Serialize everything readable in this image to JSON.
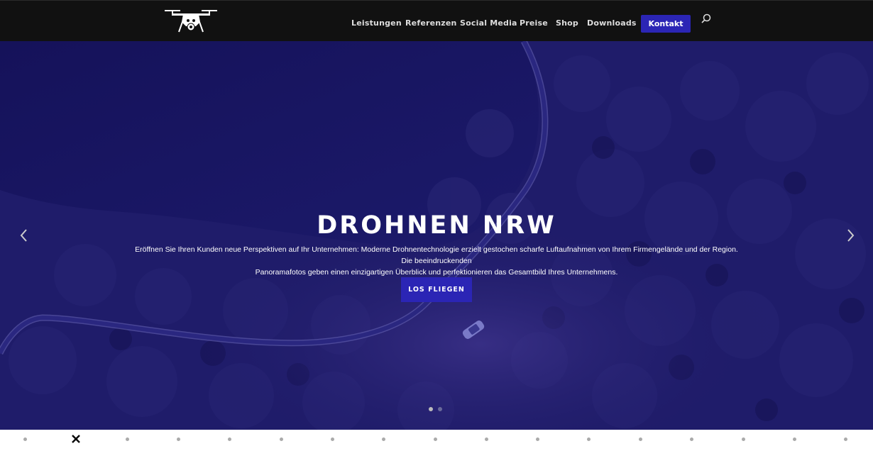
{
  "colors": {
    "header_bg": "#111111",
    "accent": "#2b25b5",
    "hero_overlay": "#1a1760",
    "nav_text": "#dddddd"
  },
  "header": {
    "logo_icon": "drone-logo-icon",
    "nav": [
      {
        "label": "Leistungen"
      },
      {
        "label": "Referenzen"
      },
      {
        "label": "Social Media"
      },
      {
        "label": "Preise"
      },
      {
        "label": "Shop"
      },
      {
        "label": "Downloads"
      }
    ],
    "cta_label": "Kontakt",
    "search_icon": "search-icon"
  },
  "hero": {
    "title": "DROHNEN NRW",
    "text_line1": "Eröffnen Sie Ihren Kunden neue Perspektiven auf Ihr Unternehmen: Moderne Drohnentechnologie erzielt gestochen scharfe Luftaufnahmen von Ihrem Firmengelände und der Region. Die beeindruckenden",
    "text_line2": "Panoramafotos geben einen einzigartigen Überblick und perfektionieren das Gesamtbild Ihres Unternehmens.",
    "button_label": "LOS FLIEGEN",
    "prev_icon": "chevron-left-icon",
    "next_icon": "chevron-right-icon",
    "slide_count": 2,
    "active_slide": 1
  },
  "strip": {
    "close_icon": "close-icon",
    "dot_count": 16
  }
}
